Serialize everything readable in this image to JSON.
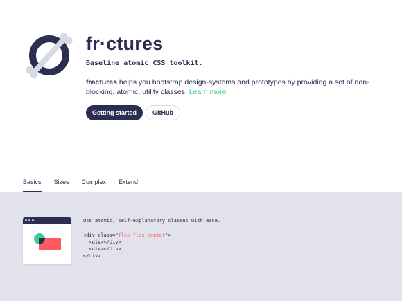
{
  "hero": {
    "title": "fr·ctures",
    "tagline": "Baseline atomic CSS toolkit.",
    "description": {
      "brand": "fractures",
      "text": " helps you bootstrap design-systems and prototypes by providing a set of non-blocking, atomic, utility classes.",
      "link": "Learn more."
    },
    "buttons": {
      "primary": "Getting started",
      "secondary": "GitHub"
    }
  },
  "tabs": [
    {
      "label": "Basics",
      "active": true
    },
    {
      "label": "Sizes",
      "active": false
    },
    {
      "label": "Complex",
      "active": false
    },
    {
      "label": "Extend",
      "active": false
    }
  ],
  "example": {
    "intro": "Use atomic, self-explanatory classes with ease.",
    "code": {
      "open_prefix": "<div class=\"",
      "classes": "flex flex-center",
      "open_suffix": "\">",
      "child1": "  <div></div>",
      "child2": "  <div></div>",
      "close": "</div>"
    }
  },
  "colors": {
    "navy": "#2b2d52",
    "green": "#3ccf8e",
    "red": "#ff5a5f",
    "panel": "#e2e2ec",
    "bone": "#d9d9e3"
  },
  "icons": {
    "logo": "fractured-bone-logo-icon"
  }
}
